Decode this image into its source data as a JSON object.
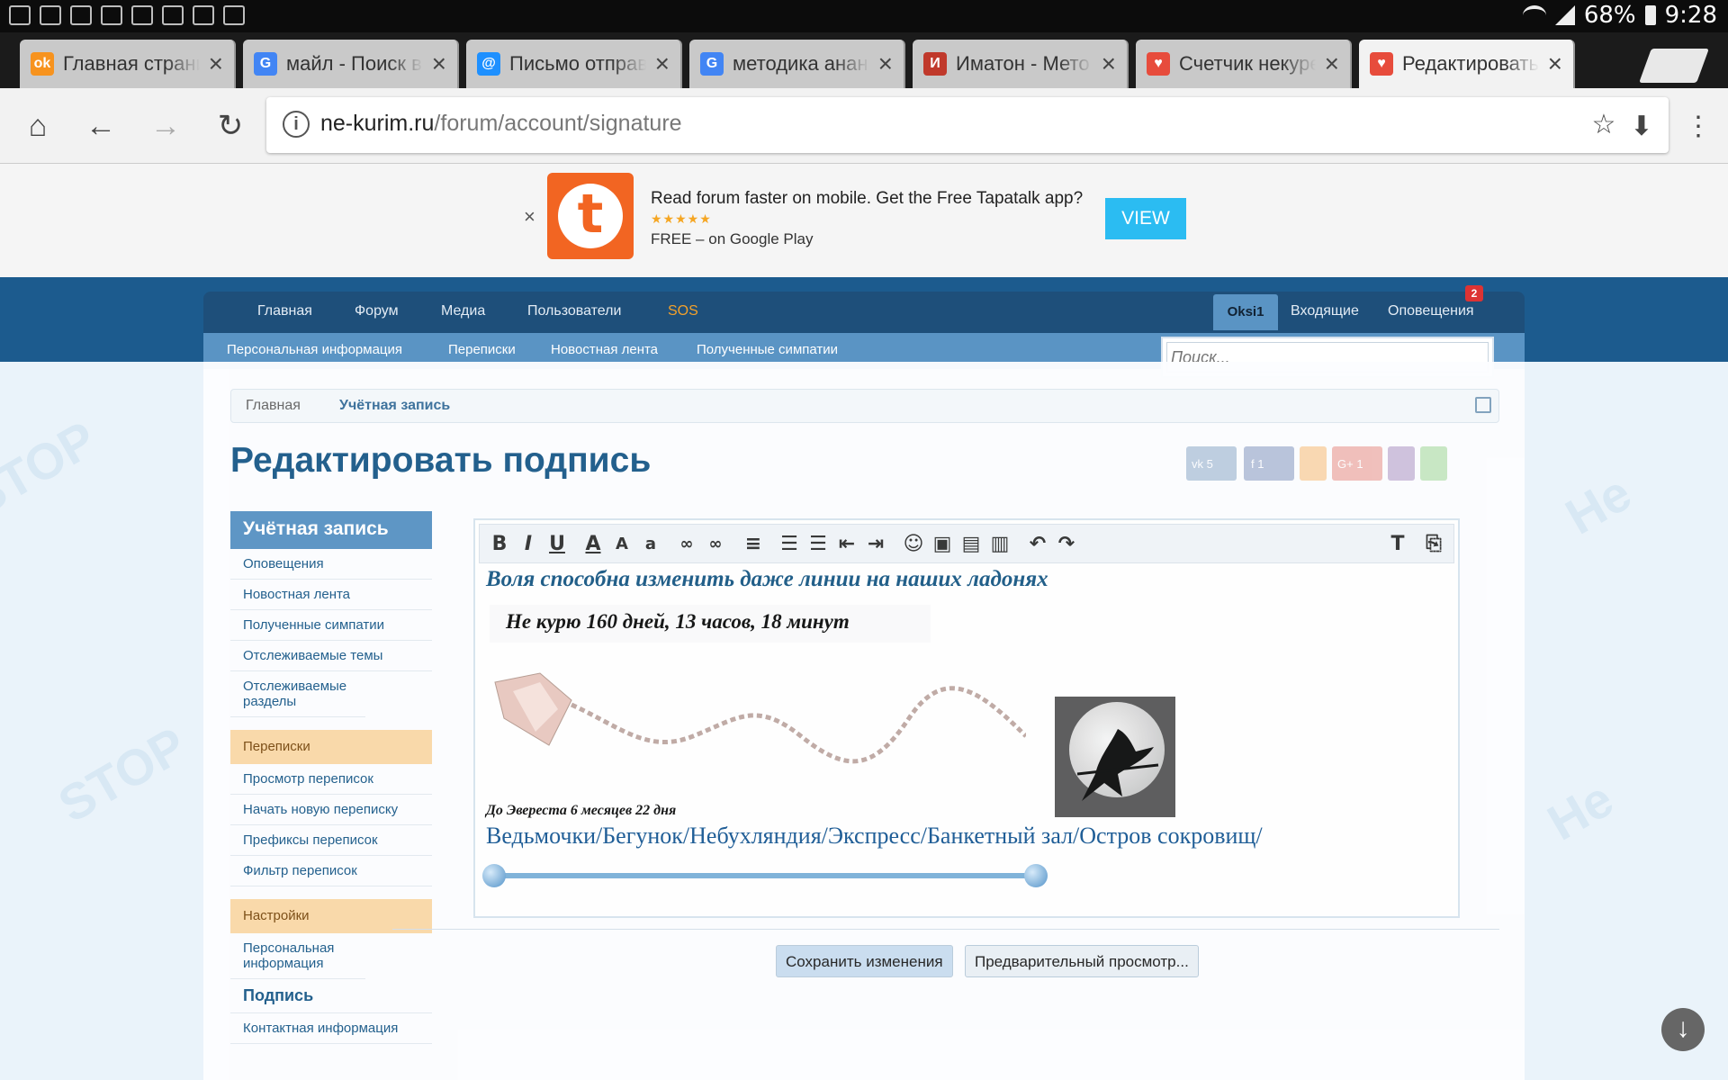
{
  "status_bar": {
    "battery": "68%",
    "time": "9:28"
  },
  "tabs": [
    {
      "title": "Главная страни",
      "favicon": "odnoklassniki-icon",
      "color": "#f7931e",
      "glyph": "ok"
    },
    {
      "title": "майл - Поиск в",
      "favicon": "google-icon",
      "color": "#4285f4",
      "glyph": "G"
    },
    {
      "title": "Письмо отправ",
      "favicon": "mail-icon",
      "color": "#1e90ff",
      "glyph": "@"
    },
    {
      "title": "методика анань",
      "favicon": "google-icon",
      "color": "#4285f4",
      "glyph": "G"
    },
    {
      "title": "Иматон - Мето",
      "favicon": "imaton-icon",
      "color": "#c0392b",
      "glyph": "И"
    },
    {
      "title": "Счетчик некуре",
      "favicon": "heart-icon",
      "color": "#e74c3c",
      "glyph": "♥"
    },
    {
      "title": "Редактировать",
      "favicon": "heart-icon",
      "color": "#e74c3c",
      "glyph": "♥"
    }
  ],
  "browser": {
    "url_host": "ne-kurim.ru",
    "url_path": "/forum/account/signature"
  },
  "banner": {
    "close": "×",
    "logo_letter": "t",
    "text": "Read forum faster on mobile. Get the Free Tapatalk app?",
    "stars": "★★★★★",
    "subtext": "FREE – on Google Play",
    "button": "VIEW"
  },
  "nav": {
    "items": [
      "Главная",
      "Форум",
      "Медиа",
      "Пользователи",
      "SOS"
    ],
    "account": "Oksi1",
    "inbox": "Входящие",
    "alerts": "Оповещения",
    "alerts_badge": "2"
  },
  "subnav": [
    "Персональная информация",
    "Переписки",
    "Новостная лента",
    "Полученные симпатии"
  ],
  "search": {
    "placeholder": "Поиск..."
  },
  "breadcrumb": [
    "Главная",
    "Учётная запись"
  ],
  "page_title": "Редактировать подпись",
  "share_counts": {
    "vk": "5",
    "fb": "1",
    "gplus": "1"
  },
  "sidebar": {
    "account_head": "Учётная запись",
    "account_links": [
      "Оповещения",
      "Новостная лента",
      "Полученные симпатии",
      "Отслеживаемые темы",
      "Отслеживаемые разделы"
    ],
    "conversations_head": "Переписки",
    "conversations_links": [
      "Просмотр переписок",
      "Начать новую переписку",
      "Префиксы переписок",
      "Фильтр переписок"
    ],
    "settings_head": "Настройки",
    "settings_links": [
      "Персональная информация"
    ],
    "settings_active": "Подпись",
    "settings_more": [
      "Контактная информация"
    ]
  },
  "editor": {
    "toolbar_icons": [
      "bold-icon",
      "italic-icon",
      "underline-icon",
      "text-color-icon",
      "font-size-icon",
      "font-family-icon",
      "link-icon",
      "unlink-icon",
      "align-icon",
      "bullet-list-icon",
      "number-list-icon",
      "outdent-icon",
      "indent-icon",
      "smilie-icon",
      "image-icon",
      "media-icon",
      "insert-icon",
      "undo-icon",
      "redo-icon",
      "remove-format-icon",
      "toggle-bbcode-icon"
    ],
    "quote": "Воля способна изменить даже линии на наших ладонях",
    "counter": "Не курю 160 дней, 13 часов, 18 минут",
    "everest": "До Эвереста 6 месяцев 22 дня",
    "links": "Ведьмочки/Бегунок/Небухляндия/Экспресс/Банкетный зал/Остров сокровищ/"
  },
  "buttons": {
    "save": "Сохранить изменения",
    "preview": "Предварительный просмотр..."
  }
}
